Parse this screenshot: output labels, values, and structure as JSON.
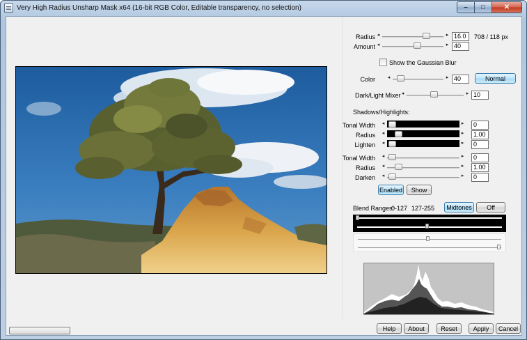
{
  "window": {
    "title": "Very High Radius Unsharp Mask x64 (16-bit RGB Color, Editable transparency, no selection)",
    "controls": {
      "minimize": "–",
      "maximize": "□",
      "close": "✕"
    }
  },
  "settings": {
    "radius": {
      "label": "Radius",
      "value": "16.0",
      "note": "708 / 118 px",
      "level": 0.8
    },
    "amount": {
      "label": "Amount",
      "value": "40",
      "level": 0.5
    },
    "show_gaussian_blur": {
      "label": "Show the Gaussian Blur",
      "checked": false
    },
    "color": {
      "label": "Color",
      "value": "40",
      "level": 0.08,
      "mode_button": "Normal"
    },
    "dark_light_mixer": {
      "label": "Dark/Light Mixer",
      "value": "10",
      "level": 0.5
    },
    "shadows_highlights_header": "Shadows/Highlights:",
    "shadows": {
      "tonal_width": {
        "label": "Tonal Width",
        "value": "0",
        "level": 0.0
      },
      "radius": {
        "label": "Radius",
        "value": "1.00",
        "level": 0.05
      },
      "lighten": {
        "label": "Lighten",
        "value": "0",
        "level": 0.0
      }
    },
    "highlights": {
      "tonal_width": {
        "label": "Tonal Width",
        "value": "0",
        "level": 0.0
      },
      "radius": {
        "label": "Radius",
        "value": "1.00",
        "level": 0.05
      },
      "darken": {
        "label": "Darken",
        "value": "0",
        "level": 0.0
      }
    },
    "enabled_button": "Enabled",
    "show_button": "Show"
  },
  "blend": {
    "label": "Blend Ranges:",
    "range1": "0-127",
    "range2": "127-255",
    "midtones_button": "Midtones",
    "off_button": "Off"
  },
  "footer": {
    "help": "Help",
    "about": "About",
    "reset": "Reset",
    "apply": "Apply",
    "cancel": "Cancel"
  },
  "colors": {
    "accent": "#3c7fb1",
    "active_button": "#bee6fd",
    "sky": "#2d6fb0",
    "rock": "#d9a44a"
  }
}
